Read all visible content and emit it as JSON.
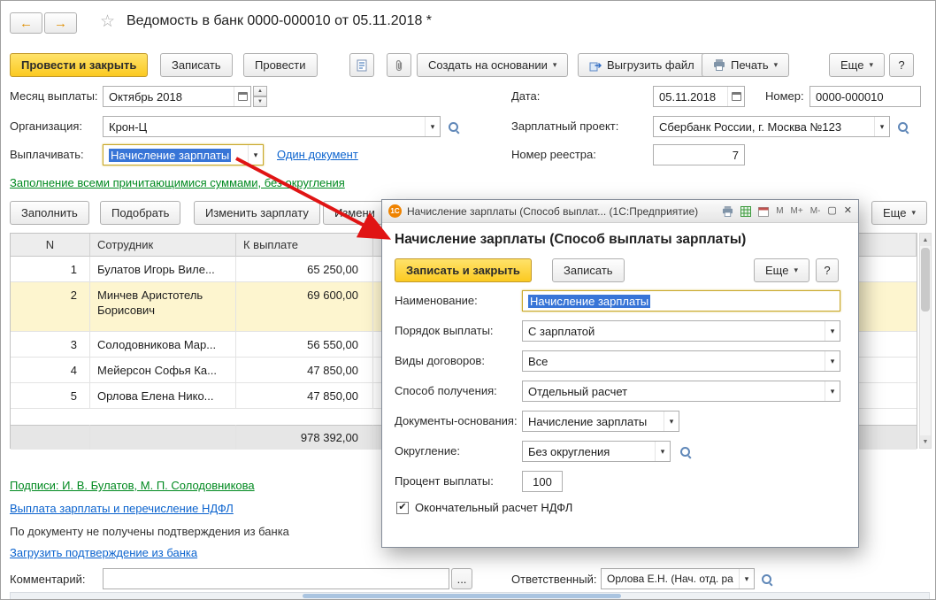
{
  "window": {
    "title": "Ведомость в банк 0000-000010 от 05.11.2018 *"
  },
  "icons": {
    "back": "←",
    "forward": "→",
    "favorite": "☆",
    "dropdown": "▾",
    "spin_up": "▲",
    "spin_down": "▼",
    "ellipsis": "...",
    "maximize": "▢",
    "close": "✕",
    "check": "✔"
  },
  "toolbar": {
    "post_and_close": "Провести и закрыть",
    "save": "Записать",
    "post": "Провести",
    "create_based_on": "Создать на основании",
    "export_file": "Выгрузить файл",
    "print": "Печать",
    "more": "Еще",
    "help": "?"
  },
  "form": {
    "month": {
      "label": "Месяц выплаты:",
      "value": "Октябрь 2018"
    },
    "date": {
      "label": "Дата:",
      "value": "05.11.2018"
    },
    "number": {
      "label": "Номер:",
      "value": "0000-000010"
    },
    "organization": {
      "label": "Организация:",
      "value": "Крон-Ц"
    },
    "project": {
      "label": "Зарплатный проект:",
      "value": "Сбербанк России, г. Москва №123"
    },
    "pay": {
      "label": "Выплачивать:",
      "value": "Начисление зарплаты"
    },
    "one_document_link": "Один документ",
    "registry": {
      "label": "Номер реестра:",
      "value": "7"
    },
    "fill_hint_link": "Заполнение всеми причитающимися суммами, без округления"
  },
  "table_toolbar": {
    "fill": "Заполнить",
    "pick": "Подобрать",
    "change_salary": "Изменить зарплату",
    "change_more": "Измени",
    "more": "Еще"
  },
  "table": {
    "columns": [
      "N",
      "Сотрудник",
      "К выплате"
    ],
    "rows": [
      {
        "n": "1",
        "employee": "Булатов Игорь Виле...",
        "amount": "65 250,00"
      },
      {
        "n": "2",
        "employee": "Минчев Аристотель Борисович",
        "amount": "69 600,00"
      },
      {
        "n": "3",
        "employee": "Солодовникова Мар...",
        "amount": "56 550,00"
      },
      {
        "n": "4",
        "employee": "Мейерсон Софья Ка...",
        "amount": "47 850,00"
      },
      {
        "n": "5",
        "employee": "Орлова Елена Нико...",
        "amount": "47 850,00"
      }
    ],
    "total": "978 392,00"
  },
  "footer": {
    "signatures_link": "Подписи: И. В. Булатов, М. П. Солодовникова",
    "payout_link": "Выплата зарплаты и перечисление НДФЛ",
    "bank_status": "По документу не получены подтверждения из банка",
    "load_confirmation_link": "Загрузить подтверждение из банка",
    "comment_label": "Комментарий:",
    "responsible": {
      "label": "Ответственный:",
      "value": "Орлова Е.Н. (Нач. отд. ра"
    }
  },
  "dialog": {
    "titlebar": "Начисление зарплаты (Способ выплат... (1С:Предприятие)",
    "logo": "1С",
    "memory": [
      "М",
      "М+",
      "М-"
    ],
    "heading": "Начисление зарплаты (Способ выплаты зарплаты)",
    "save_and_close": "Записать и закрыть",
    "save": "Записать",
    "more": "Еще",
    "help": "?",
    "fields": {
      "name": {
        "label": "Наименование:",
        "value": "Начисление зарплаты"
      },
      "pay_order": {
        "label": "Порядок выплаты:",
        "value": "С зарплатой"
      },
      "contract_types": {
        "label": "Виды договоров:",
        "value": "Все"
      },
      "receive_method": {
        "label": "Способ получения:",
        "value": "Отдельный расчет"
      },
      "base_documents": {
        "label": "Документы-основания:",
        "value": "Начисление зарплаты"
      },
      "rounding": {
        "label": "Округление:",
        "value": "Без округления"
      },
      "percent": {
        "label": "Процент выплаты:",
        "value": "100"
      }
    },
    "checkbox_label": "Окончательный расчет НДФЛ"
  },
  "colors": {
    "accent_yellow": "#fbca21",
    "selection_blue": "#3875d7",
    "link_blue": "#0b63ce",
    "link_green": "#00891f",
    "row_highlight": "#fdf5cf",
    "arrow_red": "#e01414"
  }
}
